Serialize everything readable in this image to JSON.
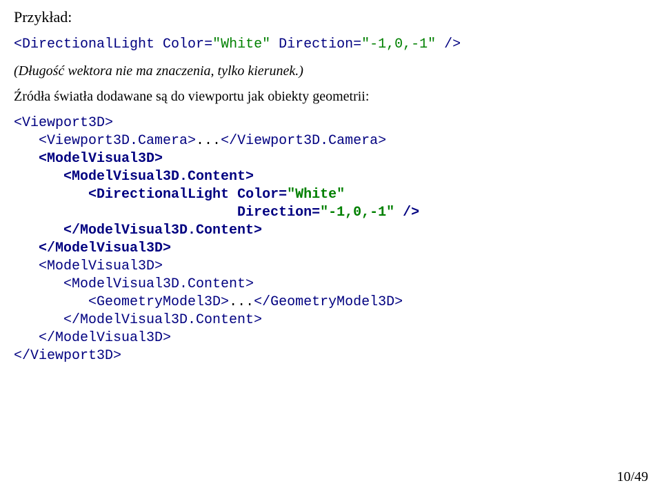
{
  "heading": "Przykład:",
  "code1": {
    "tag_open": "<DirectionalLight",
    "attr1_name": " Color",
    "eq1": "=",
    "attr1_val": "\"White\"",
    "attr2_name": " Direction",
    "eq2": "=",
    "attr2_val": "\"-1,0,-1\"",
    "tag_close": " />"
  },
  "note": "(Długość wektora nie ma znaczenia, tylko kierunek.)",
  "para": "Źródła światła dodawane są do viewportu jak obiekty geometrii:",
  "code2": {
    "l1": "<Viewport3D>",
    "l2_a": "   <Viewport3D.Camera>",
    "l2_b": "...",
    "l2_c": "</Viewport3D.Camera>",
    "l3": "   <ModelVisual3D>",
    "l4": "      <ModelVisual3D.Content>",
    "l5_a": "         <DirectionalLight",
    "l5_b": " Color",
    "l5_eq": "=",
    "l5_c": "\"White\"",
    "l6_a": "                           Direction",
    "l6_eq": "=",
    "l6_b": "\"-1,0,-1\"",
    "l6_c": " />",
    "l7": "      </ModelVisual3D.Content>",
    "l8": "   </ModelVisual3D>",
    "l9": "   <ModelVisual3D>",
    "l10": "      <ModelVisual3D.Content>",
    "l11_a": "         <GeometryModel3D>",
    "l11_b": "...",
    "l11_c": "</GeometryModel3D>",
    "l12": "      </ModelVisual3D.Content>",
    "l13": "   </ModelVisual3D>",
    "l14": "</Viewport3D>"
  },
  "page_num": "10/49"
}
